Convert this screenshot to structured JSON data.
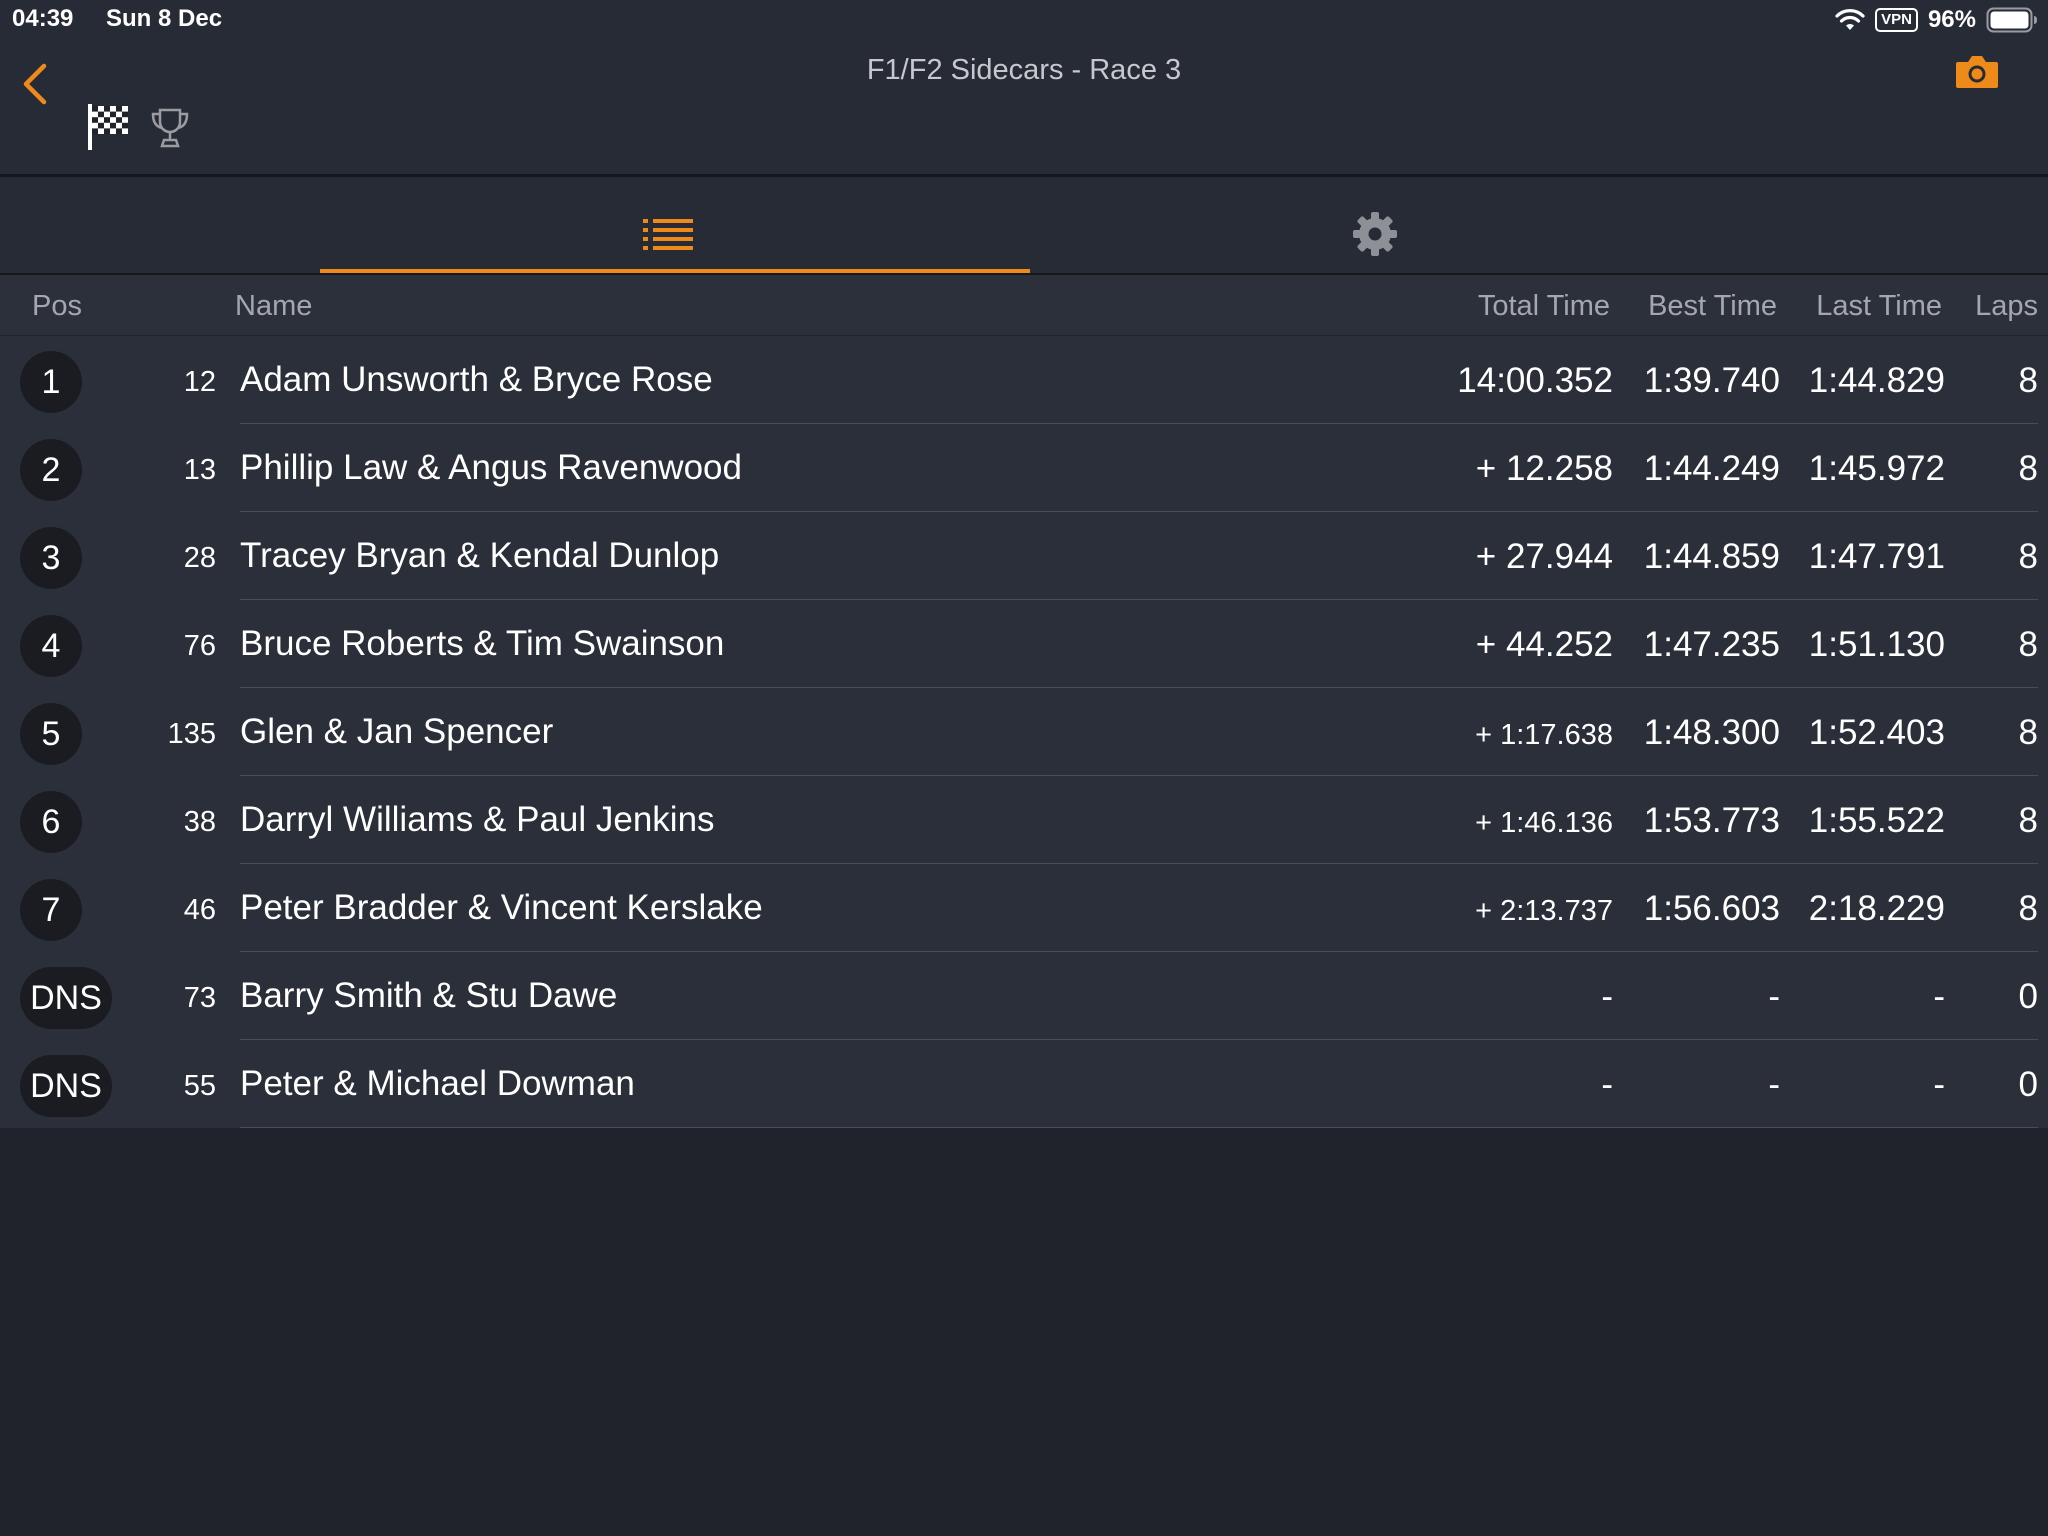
{
  "status_bar": {
    "time": "04:39",
    "date": "Sun 8 Dec",
    "vpn": "VPN",
    "battery": "96%"
  },
  "header": {
    "title": "F1/F2 Sidecars - Race 3"
  },
  "colors": {
    "accent": "#ee8a1a",
    "background": "#20232c",
    "panel": "#272b35",
    "row": "#2b2f39"
  },
  "icons": {
    "back": "chevron-left-icon",
    "flag": "checkered-flag-icon",
    "trophy": "trophy-icon",
    "camera": "camera-icon",
    "list": "list-icon",
    "settings": "gear-icon"
  },
  "table": {
    "headers": {
      "pos": "Pos",
      "name": "Name",
      "total": "Total Time",
      "best": "Best Time",
      "last": "Last Time",
      "laps": "Laps"
    },
    "rows": [
      {
        "pos": "1",
        "num": "12",
        "name": "Adam Unsworth & Bryce Rose",
        "total": "14:00.352",
        "best": "1:39.740",
        "last": "1:44.829",
        "laps": "8"
      },
      {
        "pos": "2",
        "num": "13",
        "name": "Phillip Law & Angus Ravenwood",
        "total": "+ 12.258",
        "best": "1:44.249",
        "last": "1:45.972",
        "laps": "8"
      },
      {
        "pos": "3",
        "num": "28",
        "name": "Tracey Bryan & Kendal Dunlop",
        "total": "+ 27.944",
        "best": "1:44.859",
        "last": "1:47.791",
        "laps": "8"
      },
      {
        "pos": "4",
        "num": "76",
        "name": "Bruce Roberts & Tim Swainson",
        "total": "+ 44.252",
        "best": "1:47.235",
        "last": "1:51.130",
        "laps": "8"
      },
      {
        "pos": "5",
        "num": "135",
        "name": "Glen & Jan Spencer",
        "total": "+ 1:17.638",
        "best": "1:48.300",
        "last": "1:52.403",
        "laps": "8"
      },
      {
        "pos": "6",
        "num": "38",
        "name": "Darryl Williams & Paul Jenkins",
        "total": "+ 1:46.136",
        "best": "1:53.773",
        "last": "1:55.522",
        "laps": "8"
      },
      {
        "pos": "7",
        "num": "46",
        "name": "Peter Bradder & Vincent Kerslake",
        "total": "+ 2:13.737",
        "best": "1:56.603",
        "last": "2:18.229",
        "laps": "8"
      },
      {
        "pos": "DNS",
        "num": "73",
        "name": "Barry Smith & Stu Dawe",
        "total": "-",
        "best": "-",
        "last": "-",
        "laps": "0"
      },
      {
        "pos": "DNS",
        "num": "55",
        "name": "Peter & Michael Dowman",
        "total": "-",
        "best": "-",
        "last": "-",
        "laps": "0"
      }
    ]
  }
}
